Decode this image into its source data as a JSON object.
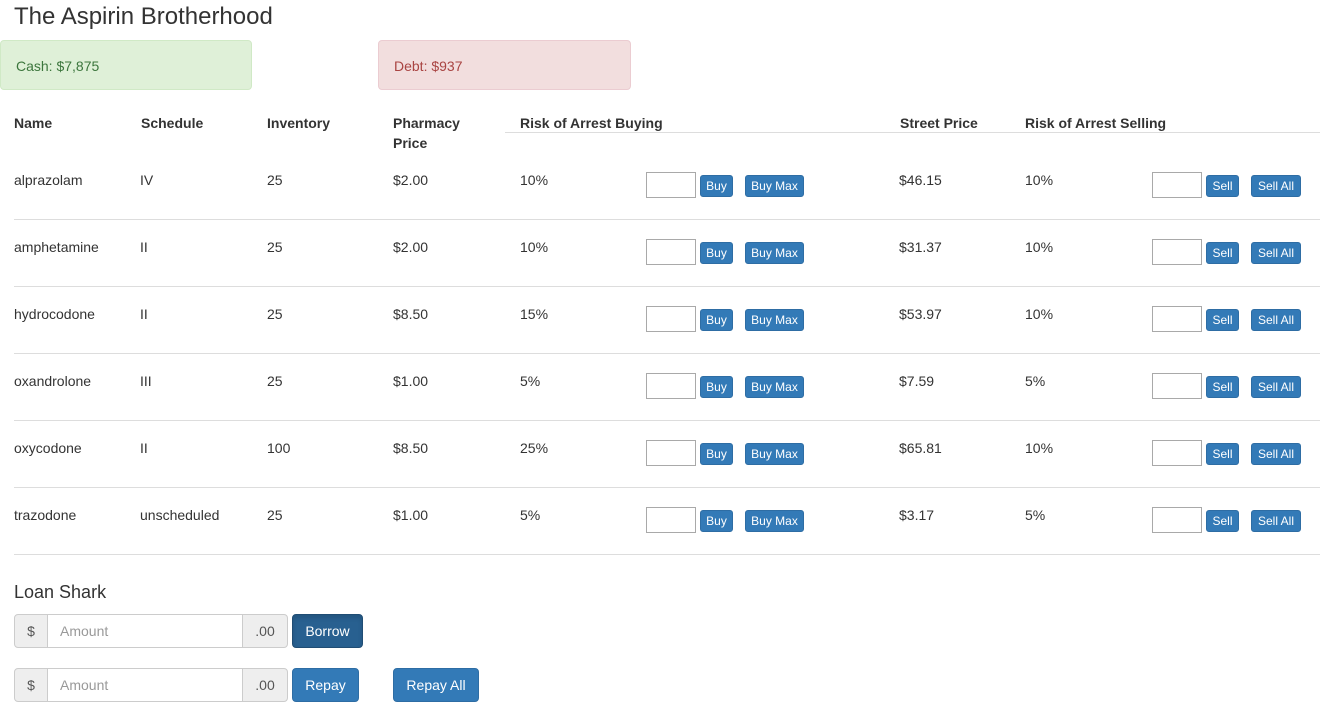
{
  "title": "The Aspirin Brotherhood",
  "cash": "Cash: $7,875",
  "debt": "Debt: $937",
  "table": {
    "headers": {
      "name": "Name",
      "schedule": "Schedule",
      "inventory": "Inventory",
      "pharmacy_price_1": "Pharmacy",
      "pharmacy_price_2": "Price",
      "risk_buying": "Risk of Arrest Buying",
      "street_price": "Street Price",
      "risk_selling": "Risk of Arrest Selling"
    },
    "rows": [
      {
        "name": "alprazolam",
        "schedule": "IV",
        "inventory": "25",
        "pharmacy_price": "$2.00",
        "risk_buying": "10%",
        "street_price": "$46.15",
        "risk_selling": "10%"
      },
      {
        "name": "amphetamine",
        "schedule": "II",
        "inventory": "25",
        "pharmacy_price": "$2.00",
        "risk_buying": "10%",
        "street_price": "$31.37",
        "risk_selling": "10%"
      },
      {
        "name": "hydrocodone",
        "schedule": "II",
        "inventory": "25",
        "pharmacy_price": "$8.50",
        "risk_buying": "15%",
        "street_price": "$53.97",
        "risk_selling": "10%"
      },
      {
        "name": "oxandrolone",
        "schedule": "III",
        "inventory": "25",
        "pharmacy_price": "$1.00",
        "risk_buying": "5%",
        "street_price": "$7.59",
        "risk_selling": "5%"
      },
      {
        "name": "oxycodone",
        "schedule": "II",
        "inventory": "100",
        "pharmacy_price": "$8.50",
        "risk_buying": "25%",
        "street_price": "$65.81",
        "risk_selling": "10%"
      },
      {
        "name": "trazodone",
        "schedule": "unscheduled",
        "inventory": "25",
        "pharmacy_price": "$1.00",
        "risk_buying": "5%",
        "street_price": "$3.17",
        "risk_selling": "5%"
      }
    ],
    "buy_label": "Buy",
    "buy_max_label": "Buy Max",
    "sell_label": "Sell",
    "sell_all_label": "Sell All"
  },
  "loan_shark": {
    "title": "Loan Shark",
    "currency_prefix": "$",
    "amount_placeholder": "Amount",
    "cents_suffix": ".00",
    "borrow_label": "Borrow",
    "repay_label": "Repay",
    "repay_all_label": "Repay All"
  }
}
